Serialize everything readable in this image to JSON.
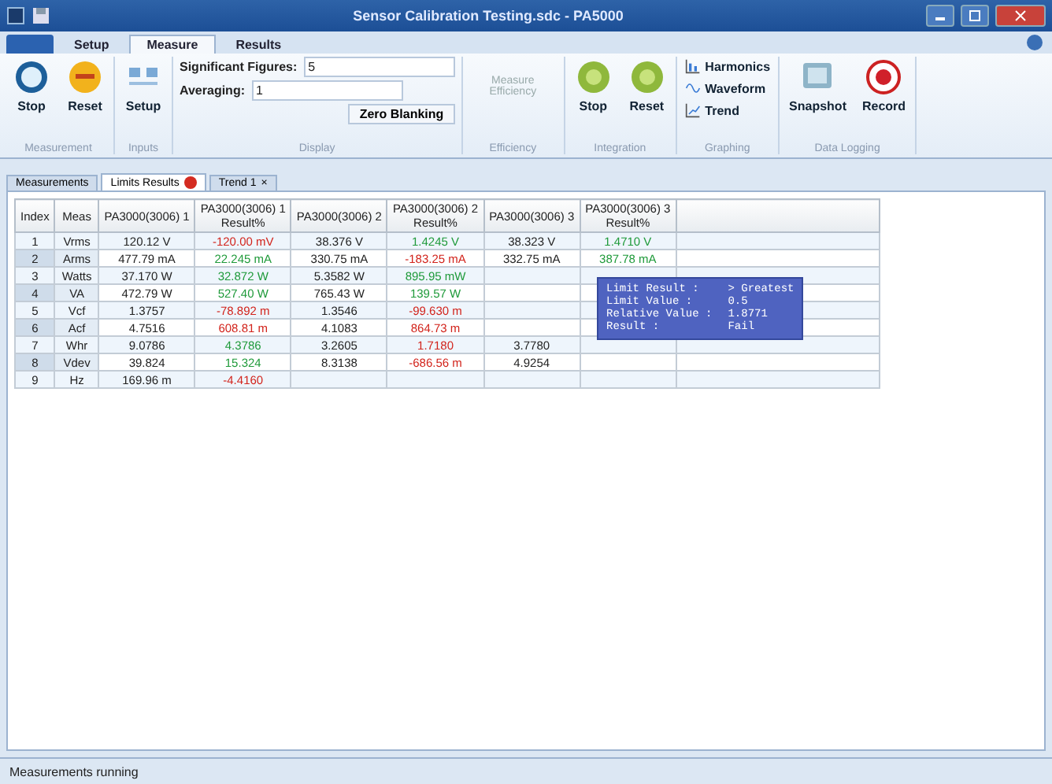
{
  "window": {
    "title": "Sensor Calibration Testing.sdc - PA5000"
  },
  "ribbon_tabs": [
    {
      "label": "Setup",
      "selected": false
    },
    {
      "label": "Measure",
      "selected": true
    },
    {
      "label": "Results",
      "selected": false
    }
  ],
  "ribbon_groups": [
    {
      "label": "Measurement",
      "items": [
        {
          "kind": "big",
          "label": "Stop"
        },
        {
          "kind": "big",
          "label": "Reset"
        }
      ]
    },
    {
      "label": "Inputs",
      "items": [
        {
          "kind": "big",
          "label": "Setup"
        }
      ]
    },
    {
      "label": "Display",
      "items": [
        {
          "kind": "combo",
          "label": "Significant Figures:",
          "value": "5"
        },
        {
          "kind": "combo",
          "label": "Averaging:",
          "value": "1"
        },
        {
          "kind": "check",
          "label": "Zero Blanking"
        }
      ]
    },
    {
      "label": "Efficiency",
      "items": [
        {
          "kind": "disabled",
          "label": "Measure Efficiency"
        }
      ]
    },
    {
      "label": "Integration",
      "items": [
        {
          "kind": "big",
          "label": "Stop"
        },
        {
          "kind": "big",
          "label": "Reset"
        }
      ]
    },
    {
      "label": "Graphing",
      "items": [
        {
          "kind": "small",
          "label": "Harmonics"
        },
        {
          "kind": "small",
          "label": "Waveform"
        },
        {
          "kind": "small",
          "label": "Trend"
        }
      ]
    },
    {
      "label": "Data Logging",
      "items": [
        {
          "kind": "big",
          "label": "Snapshot"
        },
        {
          "kind": "big",
          "label": "Record"
        }
      ]
    }
  ],
  "doc_tabs": [
    {
      "kind": "plain",
      "label": "Measurements",
      "selected": false
    },
    {
      "kind": "alert",
      "label": "Limits Results",
      "selected": true
    },
    {
      "kind": "closable",
      "label": "Trend 1",
      "selected": false,
      "close": "×"
    }
  ],
  "table": {
    "columns": [
      "Index",
      "Meas",
      "PA3000(3006) 1",
      "PA3000(3006) 1\nResult%",
      "PA3000(3006) 2",
      "PA3000(3006) 2\nResult%",
      "PA3000(3006) 3",
      "PA3000(3006) 3\nResult%"
    ],
    "rows": [
      {
        "cells": [
          {
            "text": "1"
          },
          {
            "text": "Vrms"
          },
          {
            "text": "120.12 V"
          },
          {
            "text": "-120.00 mV",
            "kind": "fail"
          },
          {
            "text": "38.376 V"
          },
          {
            "text": "1.4245 V",
            "kind": "pass"
          },
          {
            "text": "38.323 V"
          },
          {
            "text": "1.4710 V",
            "kind": "pass"
          }
        ]
      },
      {
        "cells": [
          {
            "text": "2"
          },
          {
            "text": "Arms"
          },
          {
            "text": "477.79 mA"
          },
          {
            "text": "22.245 mA",
            "kind": "pass"
          },
          {
            "text": "330.75 mA"
          },
          {
            "text": "-183.25 mA",
            "kind": "fail"
          },
          {
            "text": "332.75 mA"
          },
          {
            "text": "387.78 mA",
            "kind": "pass"
          }
        ]
      },
      {
        "cells": [
          {
            "text": "3"
          },
          {
            "text": "Watts"
          },
          {
            "text": "37.170 W"
          },
          {
            "text": "32.872 W",
            "kind": "pass"
          },
          {
            "text": "5.3582 W"
          },
          {
            "text": "895.95 mW",
            "kind": "pass"
          },
          null,
          null
        ]
      },
      {
        "cells": [
          {
            "text": "4"
          },
          {
            "text": "VA"
          },
          {
            "text": "472.79 W"
          },
          {
            "text": "527.40 W",
            "kind": "pass"
          },
          {
            "text": "765.43 W"
          },
          {
            "text": "139.57 W",
            "kind": "pass"
          },
          null,
          null
        ]
      },
      {
        "cells": [
          {
            "text": "5"
          },
          {
            "text": "Vcf"
          },
          {
            "text": "1.3757"
          },
          {
            "text": "-78.892 m",
            "kind": "fail"
          },
          {
            "text": "1.3546"
          },
          {
            "text": "-99.630 m",
            "kind": "fail"
          },
          null,
          null
        ]
      },
      {
        "cells": [
          {
            "text": "6"
          },
          {
            "text": "Acf"
          },
          {
            "text": "4.7516"
          },
          {
            "text": "608.81 m",
            "kind": "fail"
          },
          {
            "text": "4.1083"
          },
          {
            "text": "864.73 m",
            "kind": "fail"
          },
          null,
          null
        ]
      },
      {
        "cells": [
          {
            "text": "7"
          },
          {
            "text": "Whr"
          },
          {
            "text": "9.0786"
          },
          {
            "text": "4.3786",
            "kind": "pass"
          },
          {
            "text": "3.2605"
          },
          {
            "text": "1.7180",
            "kind": "fail"
          },
          {
            "text": "3.7780"
          },
          null
        ]
      },
      {
        "cells": [
          {
            "text": "8"
          },
          {
            "text": "Vdev"
          },
          {
            "text": "39.824"
          },
          {
            "text": "15.324",
            "kind": "pass"
          },
          {
            "text": "8.3138"
          },
          {
            "text": "-686.56 m",
            "kind": "fail"
          },
          {
            "text": "4.9254"
          },
          null
        ]
      },
      {
        "cells": [
          {
            "text": "9"
          },
          {
            "text": "Hz"
          },
          {
            "text": "169.96 m"
          },
          {
            "text": "-4.4160",
            "kind": "fail"
          },
          null,
          null,
          null,
          null
        ]
      }
    ]
  },
  "tooltip": {
    "lines": [
      {
        "label": "Limit Result :",
        "value": "> Greatest"
      },
      {
        "label": "Limit Value :",
        "value": "0.5"
      },
      {
        "label": "Relative Value :",
        "value": "1.8771"
      },
      {
        "label": "Result :",
        "value": "Fail"
      }
    ]
  },
  "status_bar": {
    "text": "Measurements running"
  }
}
